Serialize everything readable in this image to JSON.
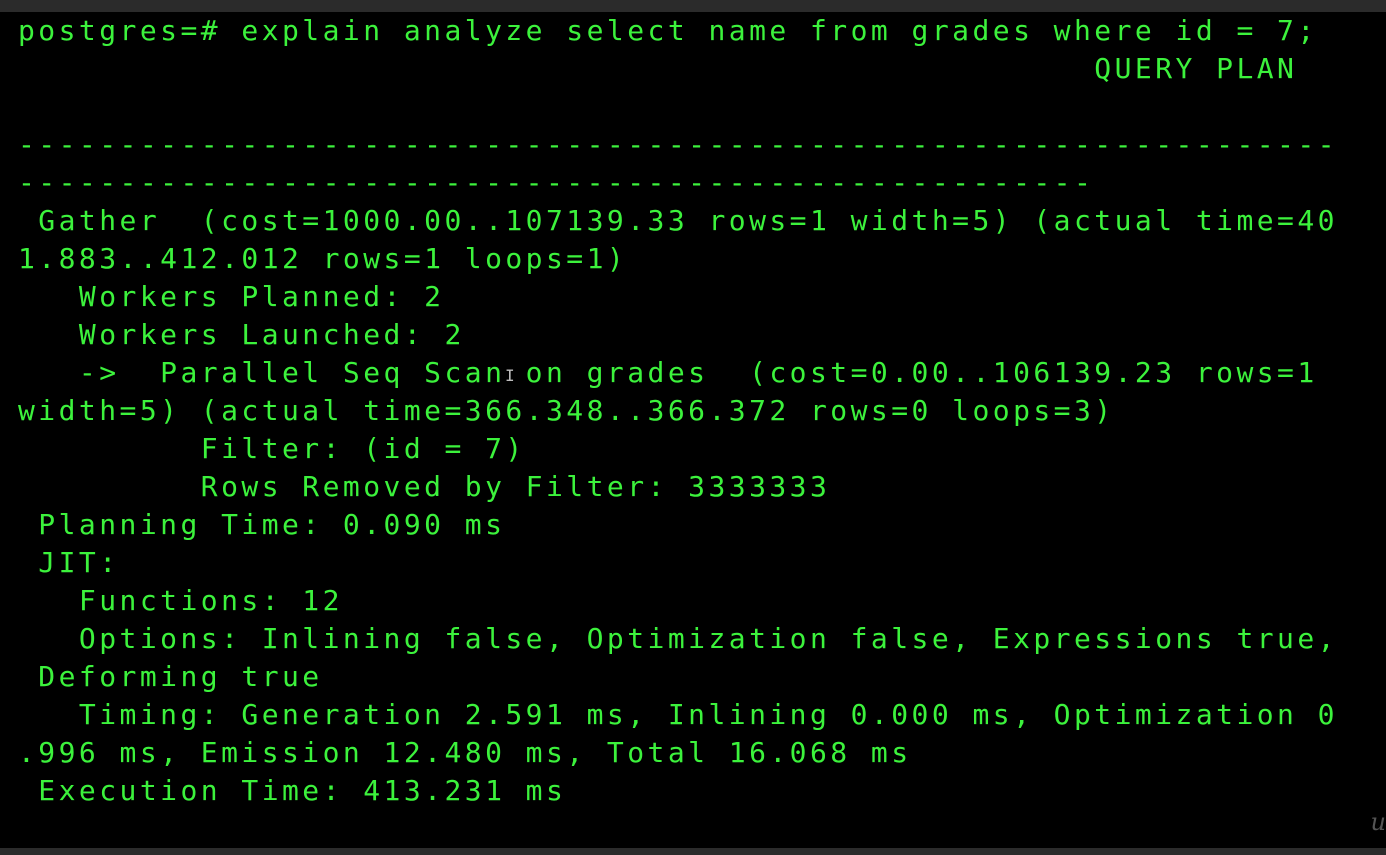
{
  "terminal": {
    "colors": {
      "background": "#000000",
      "text": "#3cf23c",
      "frame": "#2b2b2b"
    },
    "lines": [
      "postgres=# explain analyze select name from grades where id = 7;",
      "                                                     QUERY PLAN",
      "",
      "-----------------------------------------------------------------",
      "-----------------------------------------------------",
      " Gather  (cost=1000.00..107139.33 rows=1 width=5) (actual time=40",
      "1.883..412.012 rows=1 loops=1)",
      "   Workers Planned: 2",
      "   Workers Launched: 2",
      "   ->  Parallel Seq Scan on grades  (cost=0.00..106139.23 rows=1",
      "width=5) (actual time=366.348..366.372 rows=0 loops=3)",
      "         Filter: (id = 7)",
      "         Rows Removed by Filter: 3333333",
      " Planning Time: 0.090 ms",
      " JIT:",
      "   Functions: 12",
      "   Options: Inlining false, Optimization false, Expressions true,",
      " Deforming true",
      "   Timing: Generation 2.591 ms, Inlining 0.000 ms, Optimization 0",
      ".996 ms, Emission 12.480 ms, Total 16.068 ms",
      " Execution Time: 413.231 ms"
    ],
    "cursor_icon": "text-cursor-ibeam",
    "watermark_text": "u"
  }
}
